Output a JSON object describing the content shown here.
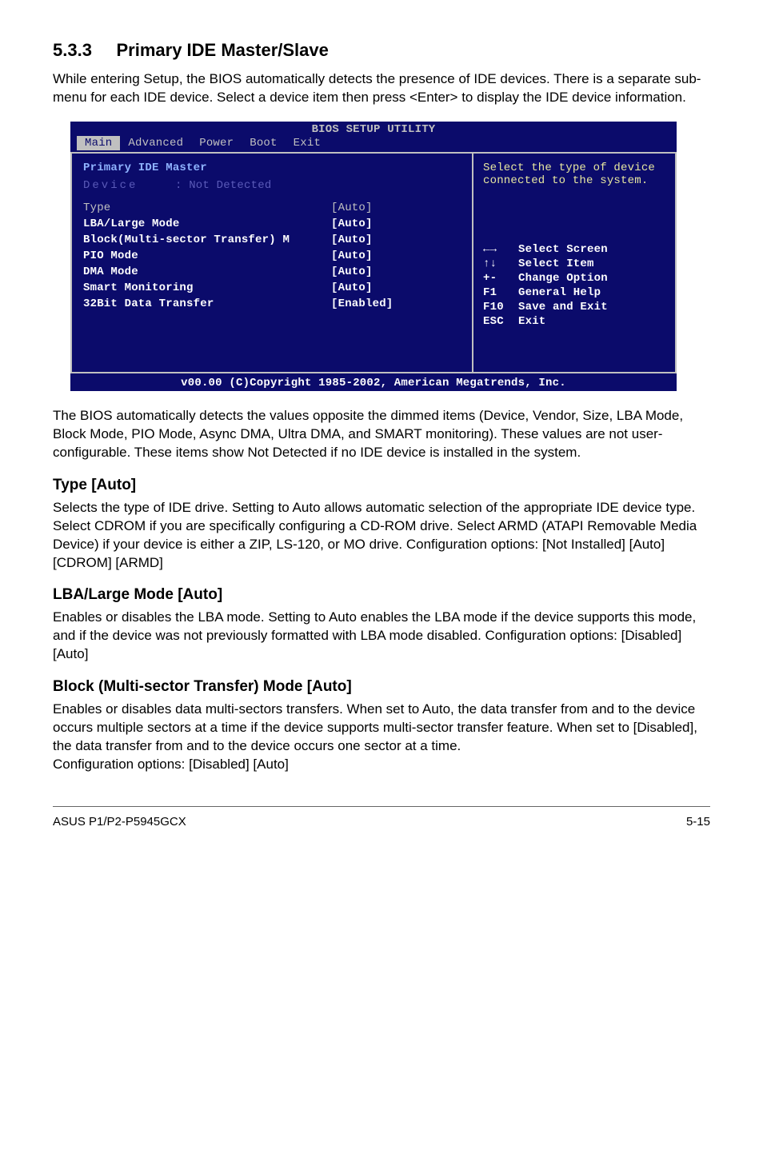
{
  "section": {
    "number": "5.3.3",
    "title_text": "Primary IDE Master/Slave",
    "intro": "While entering Setup, the BIOS automatically detects the presence of IDE devices. There is a separate sub-menu for each IDE device. Select a device item then press <Enter> to display the IDE device information."
  },
  "bios": {
    "title": "BIOS SETUP UTILITY",
    "tabs": [
      "Main",
      "Advanced",
      "Power",
      "Boot",
      "Exit"
    ],
    "active_tab_index": 0,
    "left": {
      "heading": "Primary IDE Master",
      "device_label": "Device",
      "device_value": ": Not Detected",
      "rows": [
        {
          "k": "Type",
          "v": "[Auto]",
          "selected": true
        },
        {
          "k": "LBA/Large Mode",
          "v": "[Auto]"
        },
        {
          "k": "Block(Multi-sector Transfer) M",
          "v": "[Auto]"
        },
        {
          "k": "PIO Mode",
          "v": "[Auto]"
        },
        {
          "k": "DMA Mode",
          "v": "[Auto]"
        },
        {
          "k": "Smart Monitoring",
          "v": "[Auto]"
        },
        {
          "k": "32Bit Data Transfer",
          "v": "[Enabled]"
        }
      ]
    },
    "right": {
      "help_text": "Select the type of device connected to the system.",
      "hints": [
        {
          "key": "←→",
          "text": "Select Screen"
        },
        {
          "key": "↑↓",
          "text": "Select Item"
        },
        {
          "key": "+-",
          "text": "Change Option"
        },
        {
          "key": "F1",
          "text": "General Help"
        },
        {
          "key": "F10",
          "text": "Save and Exit"
        },
        {
          "key": "ESC",
          "text": "Exit"
        }
      ]
    },
    "copyright": "v00.00 (C)Copyright 1985-2002, American Megatrends, Inc."
  },
  "after_bios": "The BIOS automatically detects the values opposite the dimmed items (Device, Vendor, Size, LBA Mode, Block Mode, PIO Mode, Async DMA, Ultra DMA, and SMART monitoring). These values are not user-configurable. These items show Not Detected if no IDE device is installed in the system.",
  "subsections": [
    {
      "title": "Type [Auto]",
      "body": "Selects the type of IDE drive. Setting to Auto allows automatic selection of the appropriate IDE device type. Select CDROM if you are specifically configuring a CD-ROM drive. Select ARMD (ATAPI Removable Media Device) if your device is either a ZIP, LS-120, or MO drive. Configuration options: [Not Installed] [Auto] [CDROM] [ARMD]"
    },
    {
      "title": "LBA/Large Mode [Auto]",
      "body": "Enables or disables the LBA mode. Setting to Auto enables the LBA mode if the device supports this mode, and if the device was not previously formatted with LBA mode disabled. Configuration options: [Disabled] [Auto]"
    },
    {
      "title": "Block (Multi-sector Transfer) Mode [Auto]",
      "body": "Enables or disables data multi-sectors transfers. When set to Auto, the data transfer from and to the device occurs multiple sectors at a time if the device supports multi-sector transfer feature. When set to [Disabled], the data transfer from and to the device occurs one sector at a time.\nConfiguration options: [Disabled] [Auto]"
    }
  ],
  "footer": {
    "left": "ASUS P1/P2-P5945GCX",
    "right": "5-15"
  }
}
